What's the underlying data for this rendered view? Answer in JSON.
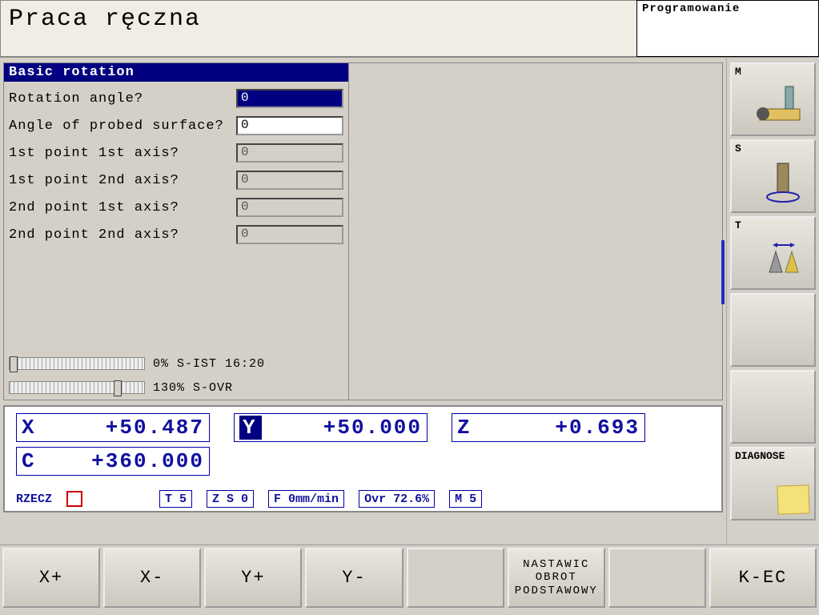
{
  "header": {
    "title": "Praca ręczna",
    "mode": "Programowanie"
  },
  "form": {
    "title": "Basic rotation",
    "rows": [
      {
        "label": "Rotation angle?",
        "value": "0",
        "editable": true,
        "selected": true
      },
      {
        "label": "Angle of probed surface?",
        "value": "0",
        "editable": true,
        "selected": false
      },
      {
        "label": "1st point 1st axis?",
        "value": "0",
        "editable": false,
        "selected": false
      },
      {
        "label": "1st point 2nd axis?",
        "value": "0",
        "editable": false,
        "selected": false
      },
      {
        "label": "2nd point 1st axis?",
        "value": "0",
        "editable": false,
        "selected": false
      },
      {
        "label": "2nd point 2nd axis?",
        "value": "0",
        "editable": false,
        "selected": false
      }
    ]
  },
  "sliders": {
    "sist": {
      "pct": "0%",
      "label": "S-IST",
      "time": "16:20"
    },
    "sovr": {
      "pct": "130%",
      "label": "S-OVR"
    }
  },
  "dro": {
    "x": {
      "axis": "X",
      "val": "+50.487"
    },
    "y": {
      "axis": "Y",
      "val": "+50.000"
    },
    "z": {
      "axis": "Z",
      "val": "+0.693"
    },
    "c": {
      "axis": "C",
      "val": "+360.000"
    }
  },
  "status": {
    "mode": "RZECZ",
    "t": "T   5",
    "zs": "Z  S   0",
    "f": "F    0mm/min",
    "ovr": "Ovr 72.6%",
    "m": "M 5"
  },
  "side": {
    "m": "M",
    "s": "S",
    "t": "T",
    "diag": "DIAGNOSE"
  },
  "softkeys": {
    "k1": "X+",
    "k2": "X-",
    "k3": "Y+",
    "k4": "Y-",
    "k5": "",
    "k6": "NASTAWIC OBROT PODSTAWOWY",
    "k7": "",
    "k8": "K-EC"
  }
}
